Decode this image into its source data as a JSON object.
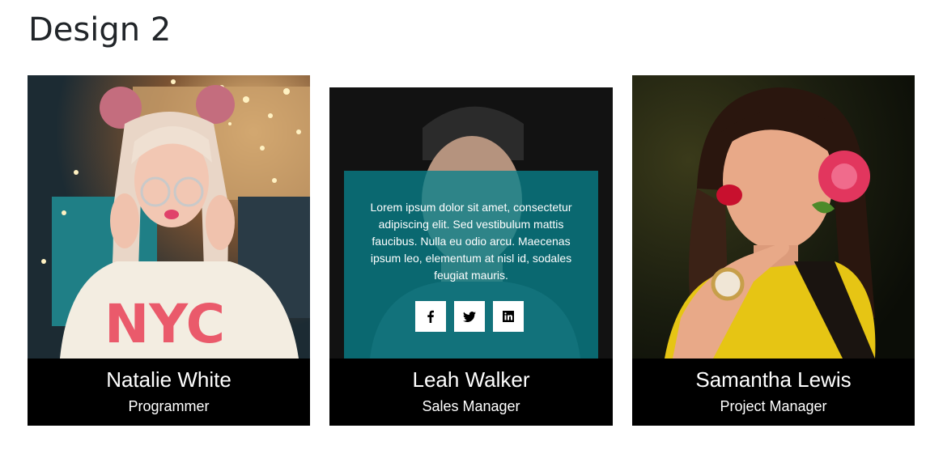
{
  "page": {
    "title": "Design 2"
  },
  "cards": [
    {
      "name": "Natalie White",
      "role": "Programmer"
    },
    {
      "name": "Leah Walker",
      "role": "Sales Manager",
      "overlay_text": "Lorem ipsum dolor sit amet, consectetur adipiscing elit. Sed vestibulum mattis faucibus. Nulla eu odio arcu. Maecenas ipsum leo, elementum at nisl id, sodales feugiat mauris.",
      "socials": [
        {
          "icon": "facebook-icon"
        },
        {
          "icon": "twitter-icon"
        },
        {
          "icon": "linkedin-icon"
        }
      ]
    },
    {
      "name": "Samantha Lewis",
      "role": "Project Manager"
    }
  ],
  "colors": {
    "overlay": "#08808a",
    "caption_bg": "#000000",
    "caption_text": "#ffffff"
  }
}
